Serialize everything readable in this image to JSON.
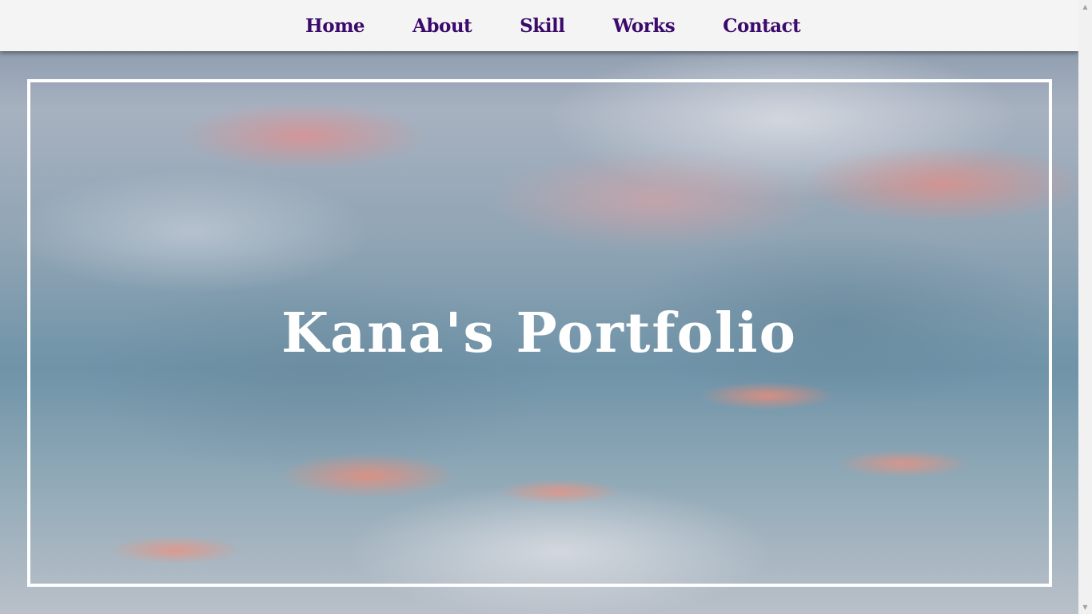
{
  "nav": {
    "items": [
      {
        "label": "Home"
      },
      {
        "label": "About"
      },
      {
        "label": "Skill"
      },
      {
        "label": "Works"
      },
      {
        "label": "Contact"
      }
    ]
  },
  "hero": {
    "title": "Kana's Portfolio"
  },
  "scrollbar": {
    "up_icon": "▲",
    "down_icon": "▼"
  },
  "colors": {
    "nav_text": "#3b0a6b",
    "nav_background": "#f4f4f4",
    "hero_text": "#ffffff",
    "frame_border": "#ffffff"
  }
}
